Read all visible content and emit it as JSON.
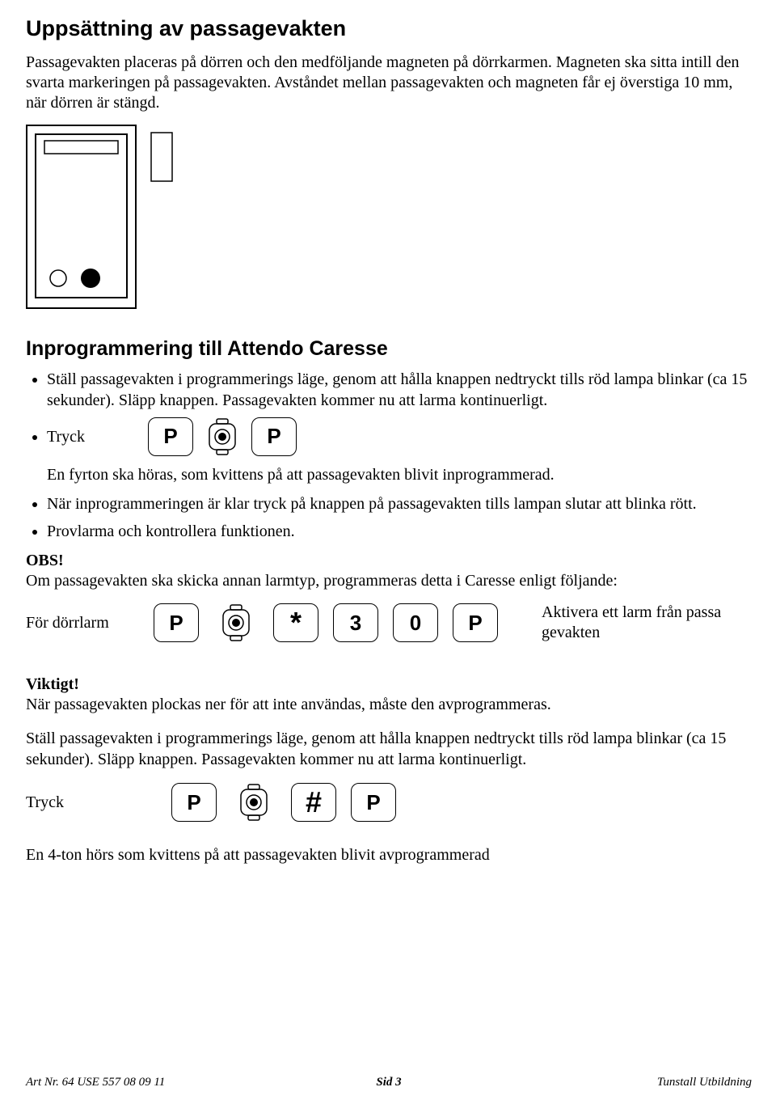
{
  "title": "Uppsättning av passagevakten",
  "intro": "Passagevakten placeras på dörren och den medföljande magneten på dörrkarmen. Magneten ska sitta intill den svarta markeringen på passagevakten. Avståndet mellan passagevakten och magneten får ej överstiga 10 mm, när dörren är stängd.",
  "section2_title": "Inprogrammering till Attendo Caresse",
  "steps": {
    "s1": "Ställ passagevakten i programmerings läge, genom att hålla knappen nedtryckt tills röd lampa blinkar (ca 15 sekunder). Släpp knappen. Passagevakten kommer nu att larma kontinuerligt.",
    "s2_label": "Tryck",
    "s2_result": "En fyrton ska höras, som kvittens på att passagevakten blivit inprogrammerad.",
    "s3": "När inprogrammeringen är klar tryck på knappen på passagevakten tills lampan slutar att blinka rött.",
    "s4": "Provlarma och kontrollera funktionen."
  },
  "obs": {
    "title": "OBS!",
    "text": "Om passagevakten ska skicka annan larmtyp, programmeras detta i Caresse enligt följande:"
  },
  "doorseq": {
    "left": "För dörrlarm",
    "right": "Aktivera ett larm från passa gevakten"
  },
  "buttons": {
    "P": "P",
    "star": "*",
    "3": "3",
    "0": "0",
    "hash": "#"
  },
  "important": {
    "title": "Viktigt!",
    "p1": "När passagevakten plockas ner för att inte användas, måste den avprogrammeras.",
    "p2": "Ställ passagevakten i programmerings läge, genom att hålla knappen nedtryckt tills röd lampa blinkar (ca 15 sekunder). Släpp knappen. Passagevakten kommer nu att larma kontinuerligt."
  },
  "tryck_label": "Tryck",
  "final": "En 4-ton hörs som kvittens på att passagevakten blivit avprogrammerad",
  "footer": {
    "left": "Art Nr. 64 USE 557   08 09 11",
    "center_prefix": "Sid ",
    "center_page": "3",
    "right": "Tunstall Utbildning"
  }
}
